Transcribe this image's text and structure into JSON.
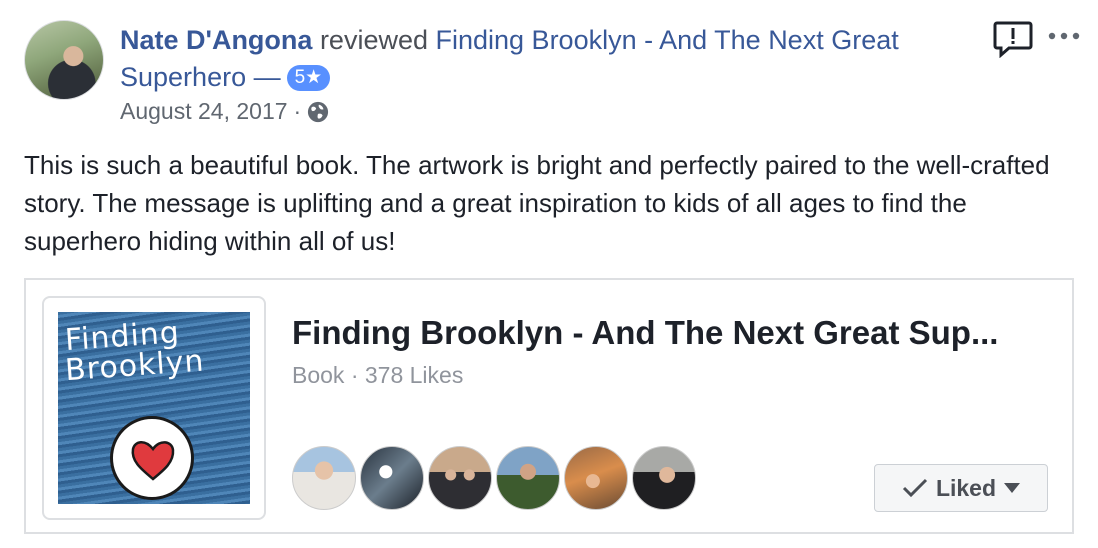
{
  "review": {
    "reviewer_name": "Nate D'Angona",
    "action_text": " reviewed ",
    "page_name": "Finding Brooklyn - And The Next Great Superhero",
    "separator": " —",
    "rating_label": "5★",
    "date": "August 24, 2017",
    "date_separator": "·",
    "privacy_icon": "globe-icon",
    "body": "This is such a beautiful book. The artwork is bright and perfectly paired to the well-crafted story. The message is uplifting and a great inspiration to kids of all ages to find the superhero hiding within all of us!"
  },
  "top_actions": {
    "report_icon": "report-icon",
    "more_icon": "more-options-icon"
  },
  "page_card": {
    "cover_title_line1": "Finding",
    "cover_title_line2": "Brooklyn",
    "title": "Finding Brooklyn - And The Next Great Sup...",
    "subtitle": "Book · 378 Likes",
    "friend_avatars": [
      "friend-avatar-1",
      "friend-avatar-2",
      "friend-avatar-3",
      "friend-avatar-4",
      "friend-avatar-5",
      "friend-avatar-6"
    ],
    "like_button_label": "Liked"
  },
  "colors": {
    "link": "#385898",
    "badge": "#5890ff",
    "muted": "#606770"
  }
}
